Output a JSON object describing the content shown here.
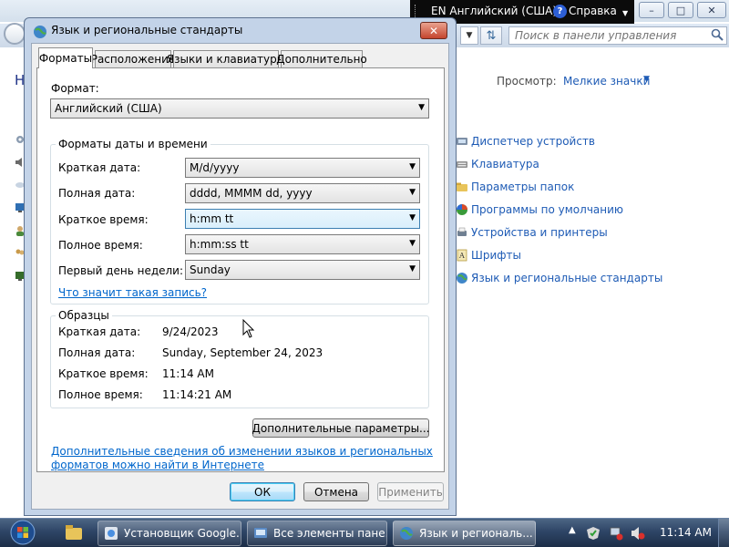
{
  "control_panel": {
    "heading_partial": "Н",
    "search_placeholder": "Поиск в панели управления",
    "view_label": "Просмотр:",
    "view_value": "Мелкие значки",
    "items": [
      {
        "label": "Диспетчер устройств",
        "icon": "device-manager-icon"
      },
      {
        "label": "Клавиатура",
        "icon": "keyboard-icon"
      },
      {
        "label": "Параметры папок",
        "icon": "folder-options-icon"
      },
      {
        "label": "Программы по умолчанию",
        "icon": "default-programs-icon"
      },
      {
        "label": "Устройства и принтеры",
        "icon": "devices-printers-icon"
      },
      {
        "label": "Шрифты",
        "icon": "fonts-icon"
      },
      {
        "label": "Язык и региональные стандарты",
        "icon": "region-language-icon"
      }
    ]
  },
  "language_bar": {
    "language": "EN Английский (США)",
    "help": "Справка"
  },
  "dialog": {
    "title": "Язык и региональные стандарты",
    "tabs": [
      {
        "label": "Форматы",
        "active": true
      },
      {
        "label": "Расположение",
        "active": false
      },
      {
        "label": "Языки и клавиатуры",
        "active": false
      },
      {
        "label": "Дополнительно",
        "active": false
      }
    ],
    "format_label": "Формат:",
    "format_value": "Английский (США)",
    "datetime_group": {
      "title": "Форматы даты и времени",
      "rows": [
        {
          "label": "Краткая дата:",
          "value": "M/d/yyyy"
        },
        {
          "label": "Полная дата:",
          "value": "dddd, MMMM dd, yyyy"
        },
        {
          "label": "Краткое время:",
          "value": "h:mm tt"
        },
        {
          "label": "Полное время:",
          "value": "h:mm:ss tt"
        },
        {
          "label": "Первый день недели:",
          "value": "Sunday"
        }
      ],
      "notation_link": "Что значит такая запись?"
    },
    "samples_group": {
      "title": "Образцы",
      "rows": [
        {
          "label": "Краткая дата:",
          "value": "9/24/2023"
        },
        {
          "label": "Полная дата:",
          "value": "Sunday, September 24, 2023"
        },
        {
          "label": "Краткое время:",
          "value": "11:14 AM"
        },
        {
          "label": "Полное время:",
          "value": "11:14:21 AM"
        }
      ]
    },
    "additional_settings_button": "Дополнительные параметры...",
    "info_link_line1": "Дополнительные сведения об изменении языков и региональных",
    "info_link_line2": "форматов можно найти в Интернете",
    "ok_button": "ОК",
    "cancel_button": "Отмена",
    "apply_button": "Применить"
  },
  "taskbar": {
    "buttons": [
      {
        "label": "Установщик Google...",
        "icon": "google-installer-icon"
      },
      {
        "label": "Все элементы пане...",
        "icon": "control-panel-icon"
      },
      {
        "label": "Язык и региональ...",
        "icon": "region-language-icon"
      }
    ],
    "clock": "11:14 AM"
  }
}
